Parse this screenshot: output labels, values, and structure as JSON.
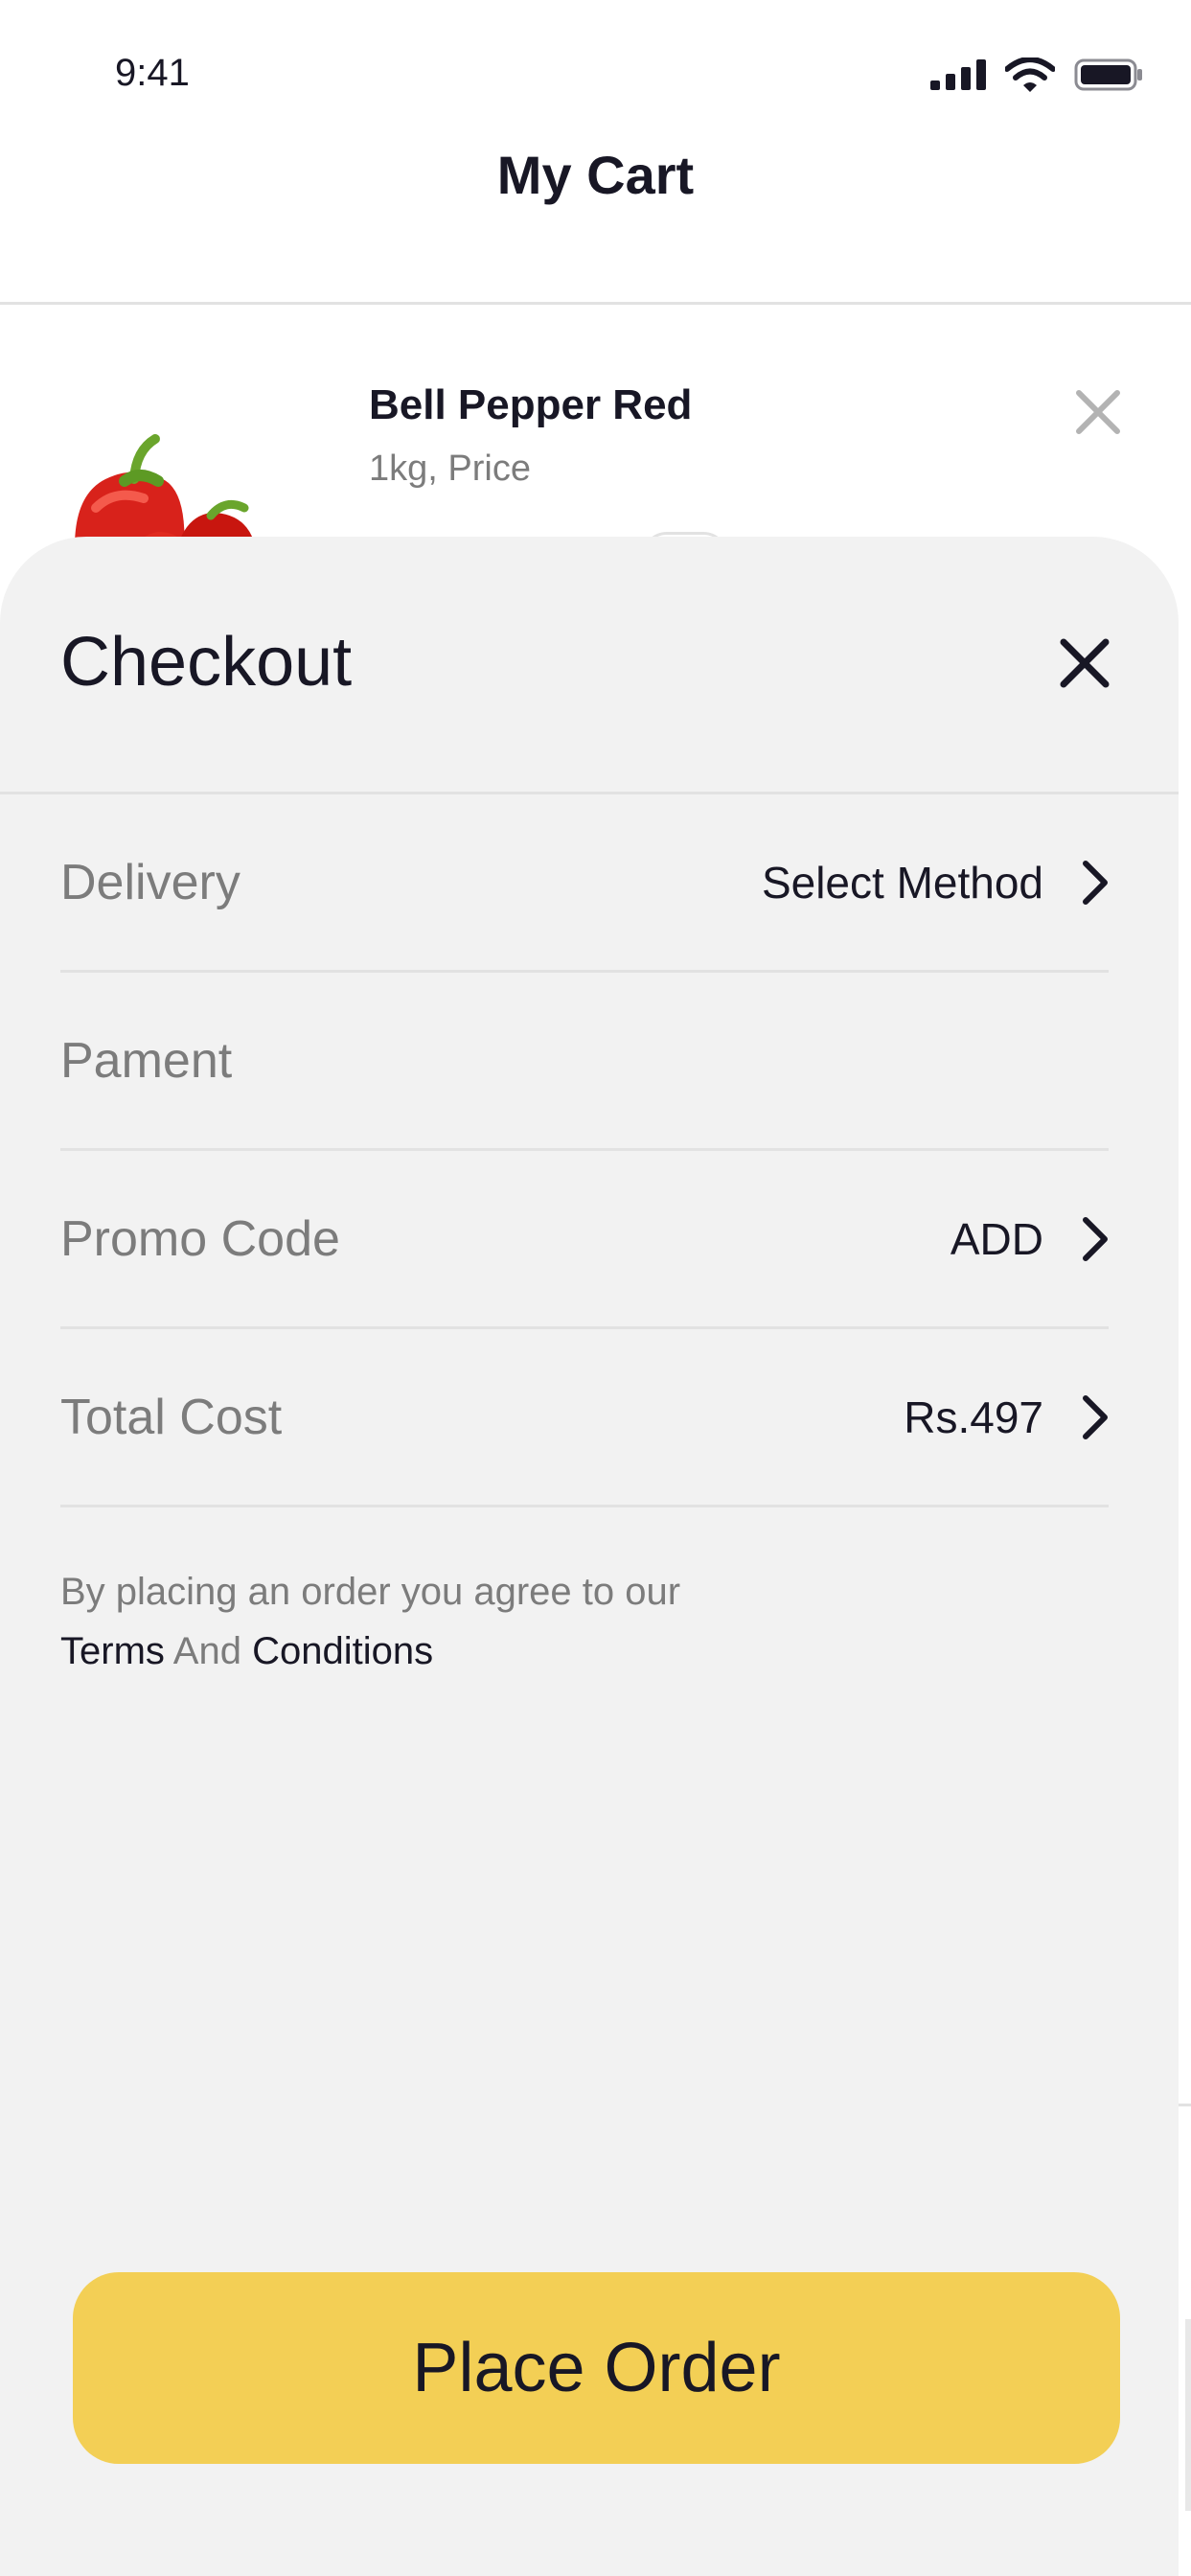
{
  "status_bar": {
    "time": "9:41"
  },
  "header": {
    "title": "My Cart"
  },
  "cart_item": {
    "name": "Bell Pepper Red",
    "subtitle": "1kg, Price"
  },
  "checkout": {
    "title": "Checkout",
    "rows": [
      {
        "label": "Delivery",
        "value": "Select Method"
      },
      {
        "label": "Pament",
        "value": ""
      },
      {
        "label": "Promo Code",
        "value": "ADD"
      },
      {
        "label": "Total Cost",
        "value": "Rs.497"
      }
    ],
    "terms": {
      "prefix": "By placing an order you agree to our",
      "terms_link": "Terms",
      "conjunction": "And",
      "conditions_link": "Conditions"
    },
    "place_order_label": "Place Order"
  },
  "colors": {
    "accent": "#F3CF55",
    "sheet_background": "#F2F2F2",
    "text_primary": "#181725",
    "text_secondary": "#7C7C7C",
    "divider": "#E2E2E2"
  },
  "icons": {
    "close": "close-icon",
    "chevron": "chevron-right-icon",
    "signal": "cellular-signal-icon",
    "wifi": "wifi-icon",
    "battery": "battery-icon",
    "product": "bell-pepper-image"
  }
}
